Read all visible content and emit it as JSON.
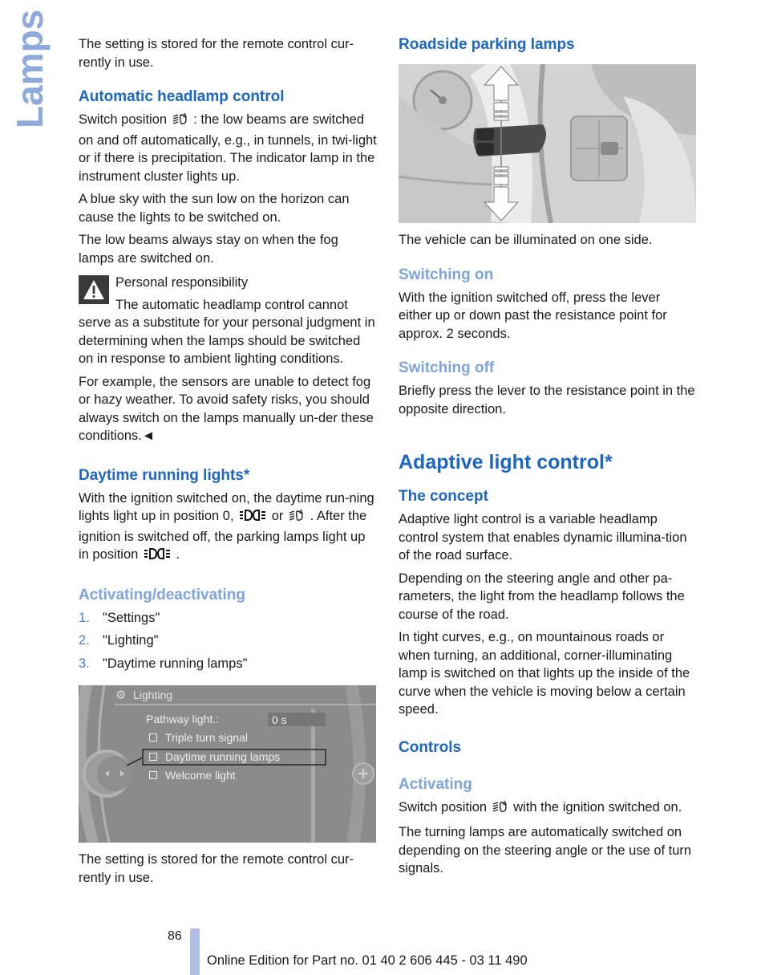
{
  "side_title": "Lamps",
  "left": {
    "intro": "The setting is stored for the remote control cur-rently in use.",
    "auto_headlamp": {
      "heading": "Automatic headlamp control",
      "p1_before": "Switch position",
      "p1_after": ": the low beams are switched on and off automatically, e.g., in tunnels, in twi-light or if there is precipitation. The indicator lamp in the instrument cluster lights up.",
      "p2": "A blue sky with the sun low on the horizon can cause the lights to be switched on.",
      "p3": "The low beams always stay on when the fog lamps are switched on."
    },
    "warning": {
      "title": "Personal responsibility",
      "p1": "The automatic headlamp control cannot serve as a substitute for your personal judgment in determining when the lamps should be switched on in response to ambient lighting conditions.",
      "p2": "For example, the sensors are unable to detect fog or hazy weather. To avoid safety risks, you should always switch on the lamps manually un-der these conditions.◄"
    },
    "drl": {
      "heading": "Daytime running lights*",
      "p1_a": "With the ignition switched on, the daytime run-ning lights light up in position 0,",
      "p1_or": "or",
      "p1_b": ". After the ignition is switched off, the parking lamps light up in position",
      "p1_end": "."
    },
    "activating": {
      "heading": "Activating/deactivating",
      "steps": [
        {
          "num": "1.",
          "text": "\"Settings\""
        },
        {
          "num": "2.",
          "text": "\"Lighting\""
        },
        {
          "num": "3.",
          "text": "\"Daytime running lamps\""
        }
      ]
    },
    "screen": {
      "title": "Lighting",
      "pathway_label": "Pathway light.:",
      "pathway_value": "0 s",
      "options": [
        "Triple turn signal",
        "Daytime running lamps",
        "Welcome light"
      ],
      "selected_index": 1
    },
    "outro": "The setting is stored for the remote control cur-rently in use."
  },
  "right": {
    "roadside": {
      "heading": "Roadside parking lamps",
      "caption": "The vehicle can be illuminated on one side."
    },
    "switching_on": {
      "heading": "Switching on",
      "text": "With the ignition switched off, press the lever either up or down past the resistance point for approx. 2 seconds."
    },
    "switching_off": {
      "heading": "Switching off",
      "text": "Briefly press the lever to the resistance point in the opposite direction."
    },
    "adaptive": {
      "heading": "Adaptive light control*",
      "concept_heading": "The concept",
      "p1": "Adaptive light control is a variable headlamp control system that enables dynamic illumina-tion of the road surface.",
      "p2": "Depending on the steering angle and other pa-rameters, the light from the headlamp follows the course of the road.",
      "p3": "In tight curves, e.g., on mountainous roads or when turning, an additional, corner-illuminating lamp is switched on that lights up the inside of the curve when the vehicle is moving below a certain speed.",
      "controls_heading": "Controls",
      "activating_heading": "Activating",
      "act_before": "Switch position",
      "act_after": "with the ignition switched on.",
      "act_p2": "The turning lamps are automatically switched on depending on the steering angle or the use of turn signals."
    }
  },
  "footer": {
    "page_number": "86",
    "edition": "Online Edition for Part no. 01 40 2 606 445 - 03 11 490"
  }
}
